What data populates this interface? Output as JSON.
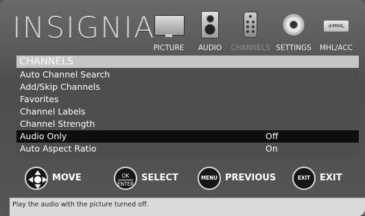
{
  "brand": {
    "logo_text": "INSIGNIA"
  },
  "tabs": [
    {
      "label": "PICTURE",
      "icon": "tv-icon"
    },
    {
      "label": "AUDIO",
      "icon": "speaker-icon"
    },
    {
      "label": "CHANNELS",
      "icon": "remote-icon",
      "active": true
    },
    {
      "label": "SETTINGS",
      "icon": "gear-icon"
    },
    {
      "label": "MHL/ACC",
      "icon": "mhl-logo-icon",
      "icon_text": "⊛MHL"
    }
  ],
  "menu": {
    "title": "CHANNELS",
    "items": [
      {
        "label": "Auto Channel Search",
        "value": ""
      },
      {
        "label": "Add/Skip Channels",
        "value": ""
      },
      {
        "label": "Favorites",
        "value": ""
      },
      {
        "label": "Channel Labels",
        "value": ""
      },
      {
        "label": "Channel Strength",
        "value": ""
      },
      {
        "label": "Audio Only",
        "value": "Off",
        "selected": true
      },
      {
        "label": "Auto Aspect Ratio",
        "value": "On"
      }
    ]
  },
  "buttons": [
    {
      "label": "MOVE",
      "key": ""
    },
    {
      "label": "SELECT",
      "key_top": "OK",
      "key_bottom": "ENTER"
    },
    {
      "label": "PREVIOUS",
      "key": "MENU"
    },
    {
      "label": "EXIT",
      "key": "EXIT"
    }
  ],
  "help_text": "Play the audio with the picture turned off.",
  "colors": {
    "title_bar": "#c6c6c6",
    "selected_row": "#0e0e0e",
    "panel": "#4e4e4e",
    "help_bg": "#dadada"
  }
}
